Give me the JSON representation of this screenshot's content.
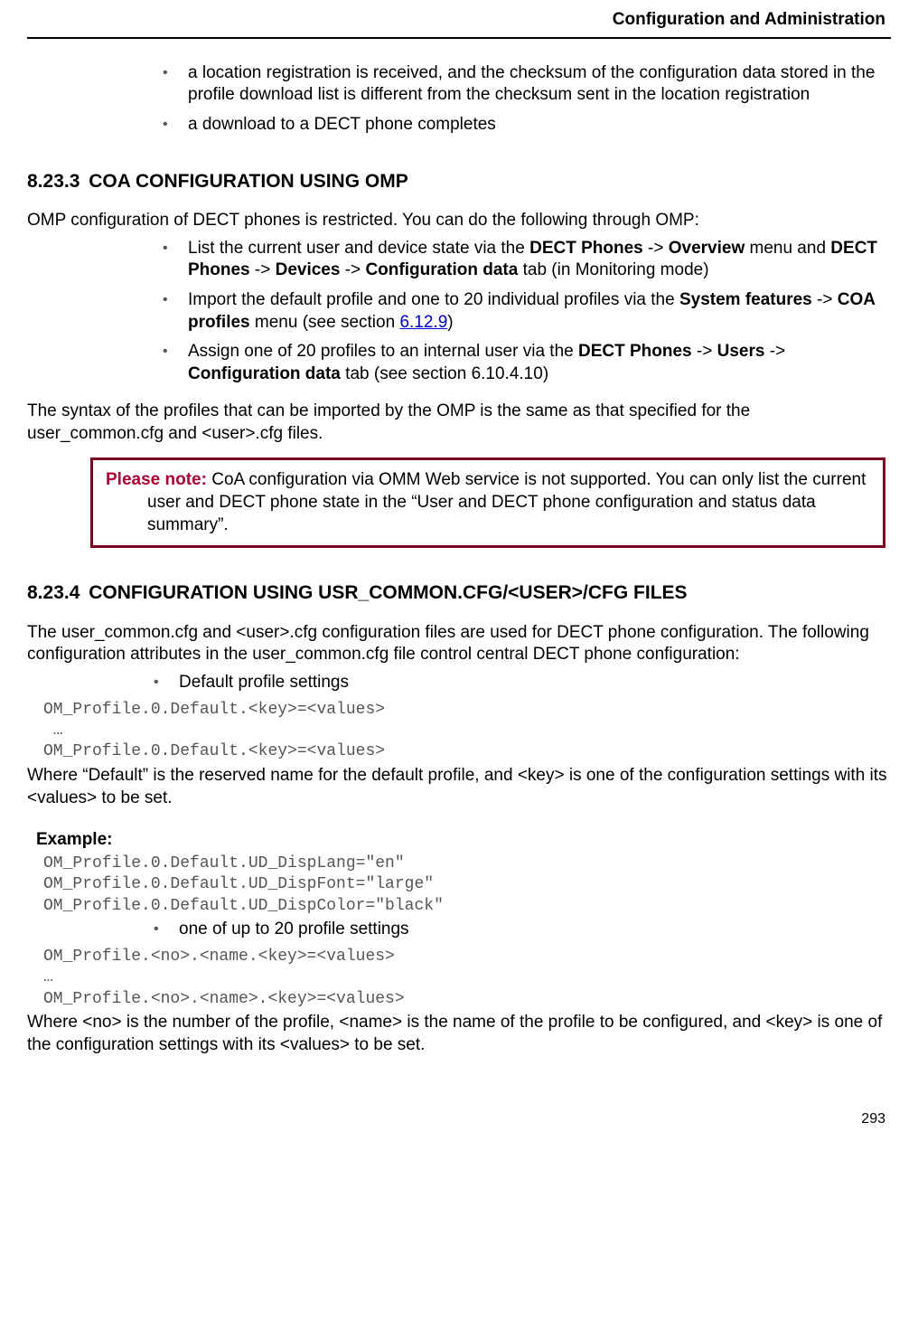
{
  "header": {
    "title": "Configuration and Administration"
  },
  "intro_bullets": [
    "a location registration is received, and the checksum of the configuration data stored in the profile download list is different from the checksum sent in the location registration",
    "a download to a DECT phone completes"
  ],
  "sec1": {
    "num": "8.23.3",
    "title": "COA CONFIGURATION USING OMP",
    "para": "OMP configuration of DECT phones is restricted.  You can do the following through OMP:",
    "b1_a": "List the current user and device state via the ",
    "b1_b": "DECT Phones",
    "b1_c": " -> ",
    "b1_d": "Overview",
    "b1_e": " menu and ",
    "b1_f": "DECT Phones",
    "b1_g": " -> ",
    "b1_h": "Devices",
    "b1_i": " -> ",
    "b1_j": "Configuration data",
    "b1_k": " tab (in Monitoring mode)",
    "b2_a": "Import the default profile and one to 20 individual profiles via the ",
    "b2_b": "System features",
    "b2_c": " -> ",
    "b2_d": "COA profiles",
    "b2_e": " menu (see section ",
    "b2_link": "6.12.9",
    "b2_f": ")",
    "b3_a": "Assign one of 20 profiles to an internal user via the ",
    "b3_b": "DECT Phones",
    "b3_c": " -> ",
    "b3_d": "Users",
    "b3_e": " -> ",
    "b3_f": "Configuration data",
    "b3_g": " tab (see section 6.10.4.10)",
    "para2": "The syntax of the profiles that can be imported by the OMP is the same as that specified for the user_common.cfg and <user>.cfg files."
  },
  "note": {
    "label": "Please note:",
    "text": "  CoA configuration via OMM Web service is not supported. You can only list the current user and DECT phone state in the “User and DECT phone configuration and status data summary”."
  },
  "sec2": {
    "num": "8.23.4",
    "title": "CONFIGURATION USING USR_COMMON.CFG/<USER>/CFG FILES",
    "para": "The user_common.cfg and <user>.cfg configuration files are used for DECT phone configuration.  The following configuration attributes in the user_common.cfg file control central DECT phone configuration:",
    "bullet1": "Default profile settings",
    "code1": "OM_Profile.0.Default.<key>=<values>\n …\nOM_Profile.0.Default.<key>=<values>",
    "para2": "Where “Default” is the reserved name for the default profile, and <key> is one of the configuration settings with its <values> to be set.",
    "example_label": "Example:",
    "code2": "OM_Profile.0.Default.UD_DispLang=\"en\"\nOM_Profile.0.Default.UD_DispFont=\"large\"\nOM_Profile.0.Default.UD_DispColor=\"black\"",
    "bullet2": "one of up to 20 profile settings",
    "code3": "OM_Profile.<no>.<name.<key>=<values>\n…\nOM_Profile.<no>.<name>.<key>=<values>",
    "para3": "Where <no> is the number of the profile, <name> is the name of the profile to be configured, and <key> is one of the configuration settings with its <values> to be set."
  },
  "footer": {
    "page": "293"
  }
}
